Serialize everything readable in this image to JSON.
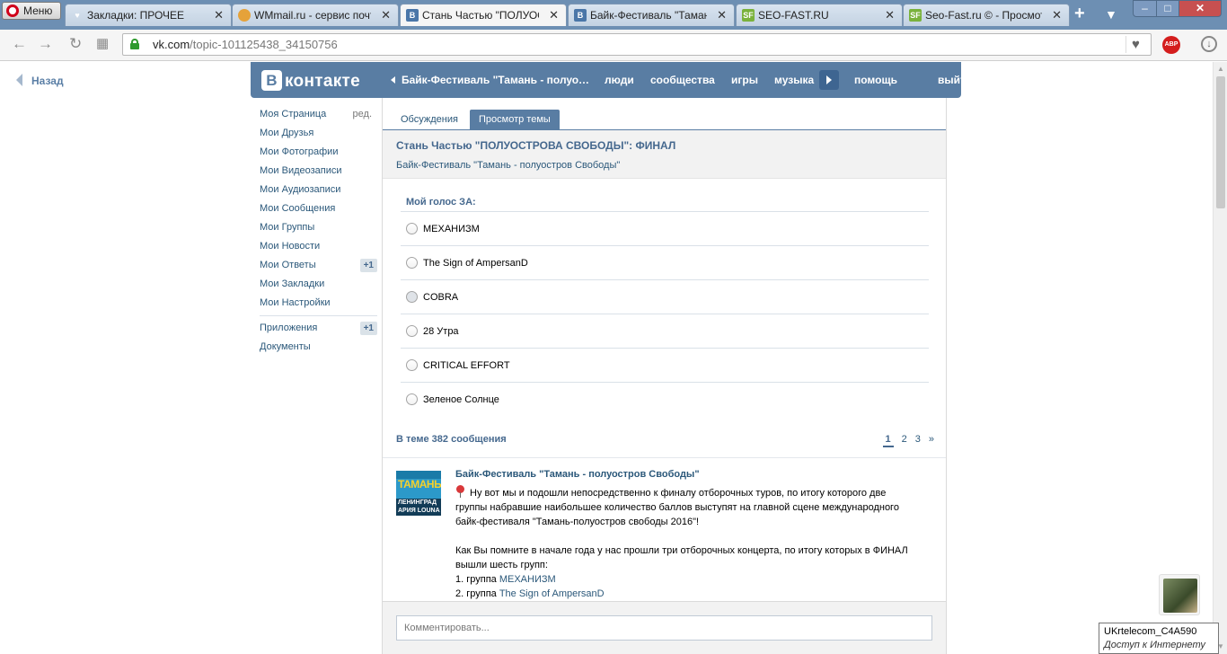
{
  "browser": {
    "menu_label": "Меню",
    "tabs": [
      {
        "title": "Закладки: ПРОЧЕЕ",
        "icon": "heart-icon",
        "active": false
      },
      {
        "title": "WMmail.ru - сервис почтовых рассылок",
        "icon": "wmmail-favicon",
        "active": false
      },
      {
        "title": "Стань Частью \"ПОЛУОСТРОВА СВОБОДЫ\"",
        "icon": "vk-favicon",
        "active": true
      },
      {
        "title": "Байк-Фестиваль \"Тамань - полуостров Свободы\"",
        "icon": "vk-favicon",
        "active": false
      },
      {
        "title": "SEO-FAST.RU",
        "icon": "seofast-favicon",
        "active": false
      },
      {
        "title": "Seo-Fast.ru © - Просмотр",
        "icon": "seofast-favicon",
        "active": false
      }
    ],
    "url_domain": "vk.com",
    "url_path": "/topic-101125438_34150756",
    "abp_label": "ABP"
  },
  "page": {
    "back_label": "Назад",
    "header": {
      "logo_b": "В",
      "logo_text": "контакте",
      "nav": {
        "topic": "Байк-Фестиваль \"Тамань - полуостров Свободы\"",
        "people": "люди",
        "communities": "сообщества",
        "games": "игры",
        "music": "музыка",
        "help": "помощь",
        "logout": "выйти"
      }
    },
    "sidebar": {
      "edit_label": "ред.",
      "items": [
        {
          "label": "Моя Страница"
        },
        {
          "label": "Мои Друзья"
        },
        {
          "label": "Мои Фотографии"
        },
        {
          "label": "Мои Видеозаписи"
        },
        {
          "label": "Мои Аудиозаписи"
        },
        {
          "label": "Мои Сообщения"
        },
        {
          "label": "Мои Группы"
        },
        {
          "label": "Мои Новости"
        },
        {
          "label": "Мои Ответы",
          "badge": "+1"
        },
        {
          "label": "Мои Закладки"
        },
        {
          "label": "Мои Настройки"
        }
      ],
      "extra": [
        {
          "label": "Приложения",
          "badge": "+1"
        },
        {
          "label": "Документы"
        }
      ]
    },
    "tabs": {
      "discussions": "Обсуждения",
      "view_topic": "Просмотр темы"
    },
    "topic": {
      "title": "Стань Частью \"ПОЛУОСТРОВА СВОБОДЫ\": ФИНАЛ",
      "group": "Байк-Фестиваль \"Тамань - полуостров Свободы\""
    },
    "poll": {
      "title": "Мой голос ЗА:",
      "options": [
        "МЕХАНИЗМ",
        "The Sign of AmpersanD",
        "COBRA",
        "28 Утра",
        "CRITICAL EFFORT",
        "Зеленое Солнце"
      ]
    },
    "messages": {
      "count_label": "В теме 382 сообщения",
      "pages": [
        "1",
        "2",
        "3",
        "»"
      ],
      "current_page": "1"
    },
    "post": {
      "author": "Байк-Фестиваль \"Тамань - полуостров Свободы\"",
      "avatar_text_top": "ТАМАНЬ",
      "avatar_text_bottom": "ЛЕНИНГРАД",
      "avatar_text_bottom2": "АРИЯ LOUNA",
      "lines": [
        "Ну вот мы и подошли непосредственно к финалу отборочных туров, по итогу которого две",
        "группы набравшие наибольшее количество баллов выступят на главной сцене международного",
        "байк-фестиваля \"Тамань-полуостров свободы 2016\"!",
        "Как Вы помните в начале года у нас прошли три отборочных концерта, по итогу которых в ФИНАЛ",
        "вышли шесть групп:"
      ],
      "list": [
        {
          "prefix": "1. группа ",
          "link": "МЕХАНИЗМ"
        },
        {
          "prefix": "2. группа ",
          "link": "The Sign of AmpersanD"
        }
      ]
    },
    "comment_placeholder": "Комментировать..."
  },
  "tooltip": {
    "network": "UKrtelecom_C4A590",
    "status": "Доступ к Интернету"
  }
}
